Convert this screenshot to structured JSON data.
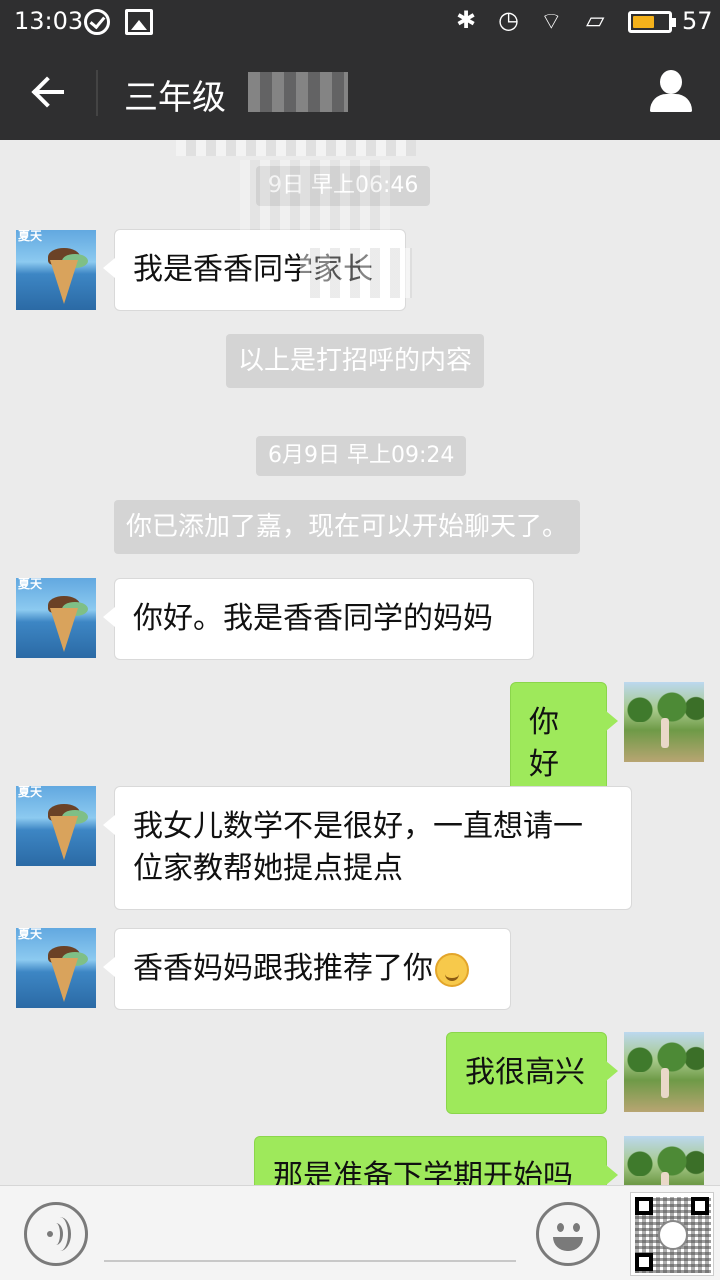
{
  "status_bar": {
    "time": "13:03",
    "battery": "57",
    "battery_level": 0.57,
    "icons": [
      "check-circle-icon",
      "image-icon",
      "bluetooth-icon",
      "alarm-icon",
      "wifi-icon",
      "rotate-screen-icon",
      "battery-icon"
    ]
  },
  "header": {
    "title": "三年级",
    "back_icon": "arrow-left-icon",
    "profile_icon": "person-icon"
  },
  "messages": {
    "ts1": "9日 早上06:46",
    "m1": "我是香香同学家长",
    "sys1": "以上是打招呼的内容",
    "ts2": "6月9日 早上09:24",
    "sys2": "你已添加了嘉，现在可以开始聊天了。",
    "m2": "你好。我是香香同学的妈妈",
    "m3": "你好",
    "m4_line1": "我女儿数学不是很好，一直想请一",
    "m4_line2": "位家教帮她提点提点",
    "m5": "香香妈妈跟我推荐了你",
    "m6": "我很高兴",
    "m7": "那是准备下学期开始吗"
  },
  "input_bar": {
    "placeholder": "",
    "voice_icon": "voice-icon",
    "emoji_icon": "smiley-icon",
    "qr_icon": "qr-code-icon"
  },
  "colors": {
    "bar": "#2f2f30",
    "background": "#ebebeb",
    "bubble_self": "#9ee95b",
    "bubble_other": "#ffffff",
    "system": "#d4d4d4"
  }
}
